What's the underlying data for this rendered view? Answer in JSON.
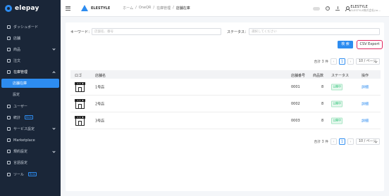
{
  "app": {
    "brand": "elepay"
  },
  "sidebar": {
    "items": [
      {
        "label": "ダッシュボード",
        "icon": "dashboard-icon"
      },
      {
        "label": "店舗",
        "icon": "store-icon"
      },
      {
        "label": "商品",
        "icon": "tag-icon",
        "expandable": true
      },
      {
        "label": "注文",
        "icon": "order-icon"
      },
      {
        "label": "在庫管理",
        "icon": "inventory-icon",
        "expandable": true,
        "open": true
      },
      {
        "label": "ユーザー",
        "icon": "user-icon"
      },
      {
        "label": "統計",
        "icon": "stats-icon",
        "badge": "Beta"
      },
      {
        "label": "サービス設定",
        "icon": "service-icon",
        "expandable": true
      },
      {
        "label": "Marketplace",
        "icon": "marketplace-icon"
      },
      {
        "label": "規約設定",
        "icon": "terms-icon",
        "expandable": true
      },
      {
        "label": "言語設定",
        "icon": "language-icon"
      },
      {
        "label": "ツール",
        "icon": "tool-icon",
        "badge": "Beta"
      }
    ],
    "sub_items": [
      {
        "label": "店舗在庫",
        "active": true
      },
      {
        "label": "設定",
        "active": false
      }
    ]
  },
  "header": {
    "org_name": "ELESTYLE",
    "breadcrumb": [
      "ホーム",
      "/",
      "OneQR",
      "/",
      "在庫管理",
      "/",
      "店舗在庫"
    ],
    "user_name": "ELESTYLE",
    "user_sub": "ELESTYLE株式会社(re..."
  },
  "filters": {
    "keyword_label": "キーワード：",
    "keyword_placeholder": "店舗名、番号",
    "status_label": "ステータス：",
    "status_placeholder": "選択してください",
    "search_label": "検 索",
    "csv_label": "CSV Export"
  },
  "pagination": {
    "total_text": "合計 3 件",
    "current_page": "1",
    "page_size": "10 / ページ",
    "prev": "‹",
    "next": "›"
  },
  "table": {
    "columns": [
      "ロゴ",
      "店舗名",
      "店舗番号",
      "商品数",
      "ステータス",
      "操作"
    ],
    "rows": [
      {
        "name": "1号店",
        "number": "0001",
        "count": "8",
        "status": "公開中",
        "action": "詳細"
      },
      {
        "name": "2号店",
        "number": "0002",
        "count": "8",
        "status": "公開中",
        "action": "詳細"
      },
      {
        "name": "3号店",
        "number": "0003",
        "count": "8",
        "status": "公開中",
        "action": "詳細"
      }
    ]
  },
  "colors": {
    "primary": "#2d8cf0",
    "sidebar_bg": "#1a2638",
    "csv_highlight": "#e0245e",
    "status_green": "#19be6b"
  }
}
